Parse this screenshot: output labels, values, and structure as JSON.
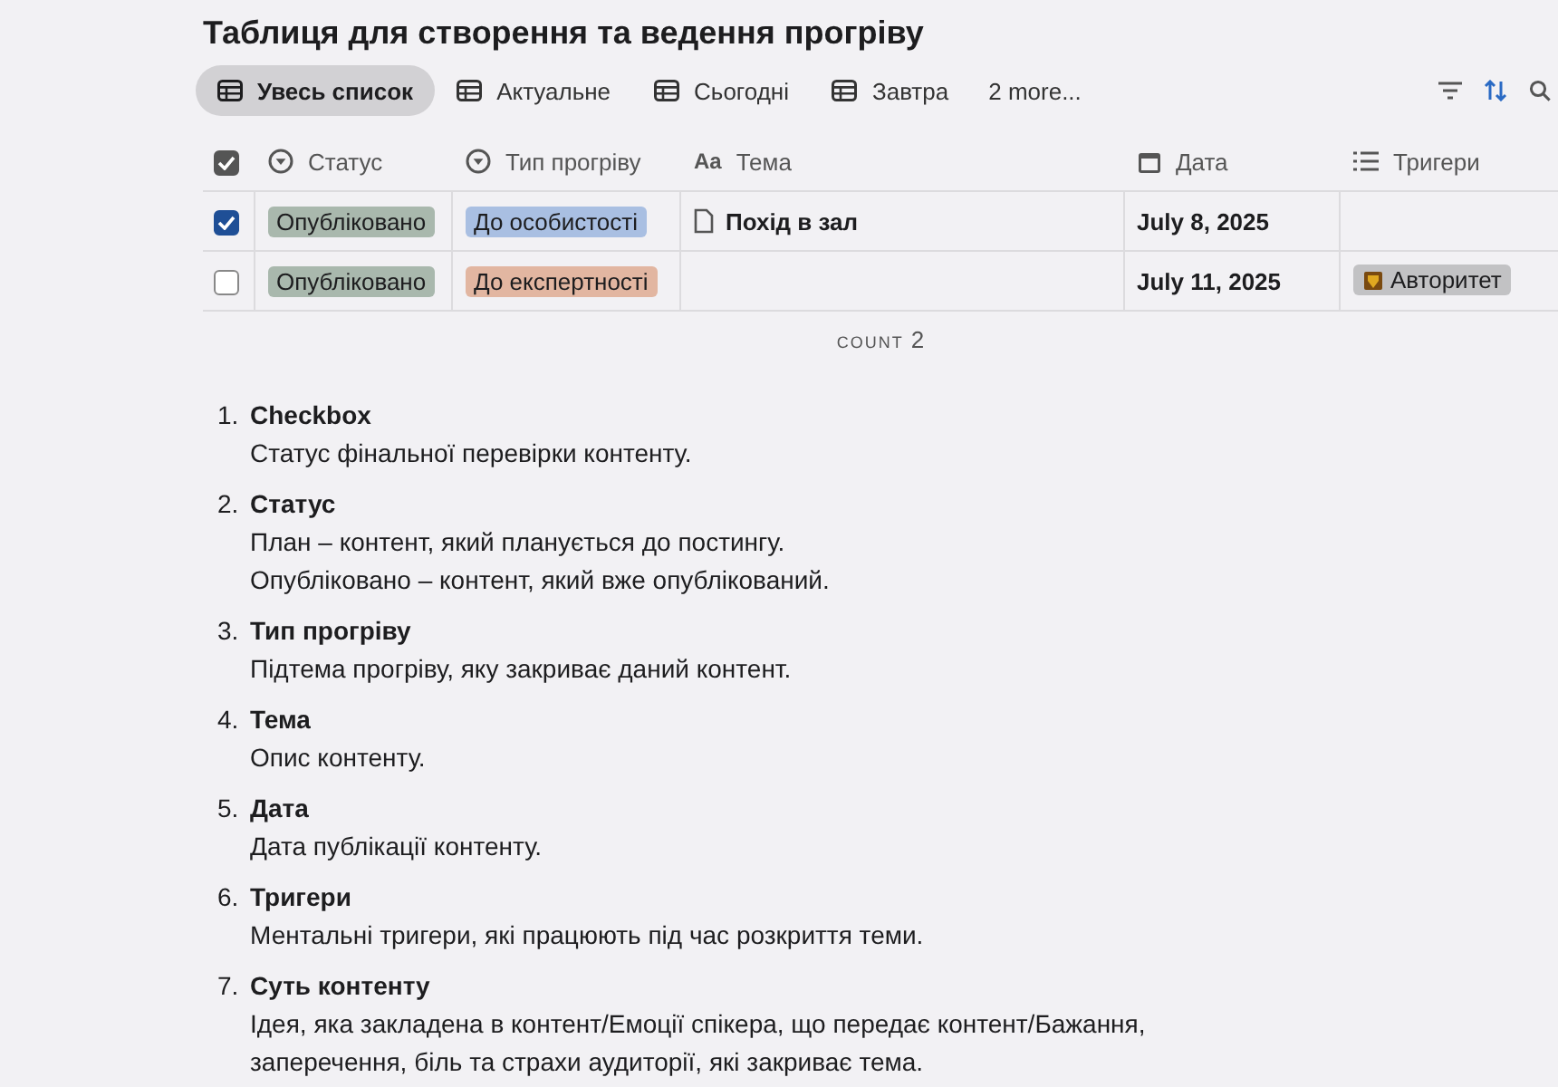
{
  "title": "Таблиця для створення та ведення прогріву",
  "tabs": [
    {
      "label": "Увесь список",
      "selected": true
    },
    {
      "label": "Актуальне",
      "selected": false
    },
    {
      "label": "Сьогодні",
      "selected": false
    },
    {
      "label": "Завтра",
      "selected": false
    }
  ],
  "more_tabs": "2 more...",
  "tools": [
    {
      "kind": "filter",
      "active": false
    },
    {
      "kind": "sort",
      "active": true
    },
    {
      "kind": "search",
      "active": false
    }
  ],
  "table": {
    "select_all": {
      "checked": true
    },
    "columns": [
      {
        "label": "Статус",
        "kind": "status"
      },
      {
        "label": "Тип прогріву",
        "kind": "select"
      },
      {
        "label": "Тема",
        "kind": "title",
        "icon": "Aa"
      },
      {
        "label": "Дата",
        "kind": "date"
      },
      {
        "label": "Тригери",
        "kind": "multi"
      }
    ],
    "rows": [
      {
        "checked": true,
        "status": {
          "label": "Опубліковано",
          "color": "#a9b8ad"
        },
        "type": {
          "label": "До особистості",
          "color": "#a9bfe2"
        },
        "topic": "Похід в зал",
        "date": "July 8, 2025",
        "triggers": []
      },
      {
        "checked": false,
        "status": {
          "label": "Опубліковано",
          "color": "#a9b8ad"
        },
        "type": {
          "label": "До експертності",
          "color": "#e2b6a1"
        },
        "topic": "",
        "date": "July 11, 2025",
        "triggers": [
          {
            "label": "Авторитет",
            "color": "#c2c2c4"
          }
        ]
      }
    ],
    "count_label": "COUNT",
    "count": "2"
  },
  "legend": [
    {
      "number": "1.",
      "title": "Checkbox",
      "lines": [
        "Статус фінальної перевірки контенту."
      ]
    },
    {
      "number": "2.",
      "title": "Статус",
      "lines": [
        "План – контент, який планується до постингу.",
        "Опубліковано – контент, який вже опублікований."
      ]
    },
    {
      "number": "3.",
      "title": "Тип прогріву",
      "lines": [
        "Підтема прогріву, яку закриває даний контент."
      ]
    },
    {
      "number": "4.",
      "title": "Тема",
      "lines": [
        "Опис контенту."
      ]
    },
    {
      "number": "5.",
      "title": "Дата",
      "lines": [
        "Дата публікації контенту."
      ]
    },
    {
      "number": "6.",
      "title": "Тригери",
      "lines": [
        "Ментальні тригери, які працюють під час розкриття теми."
      ]
    },
    {
      "number": "7.",
      "title": "Суть контенту",
      "lines": [
        "Ідея, яка закладена в контент/Емоції спікера, що передає контент/Бажання, заперечення, біль та страхи аудиторії, які закриває тема."
      ]
    }
  ]
}
